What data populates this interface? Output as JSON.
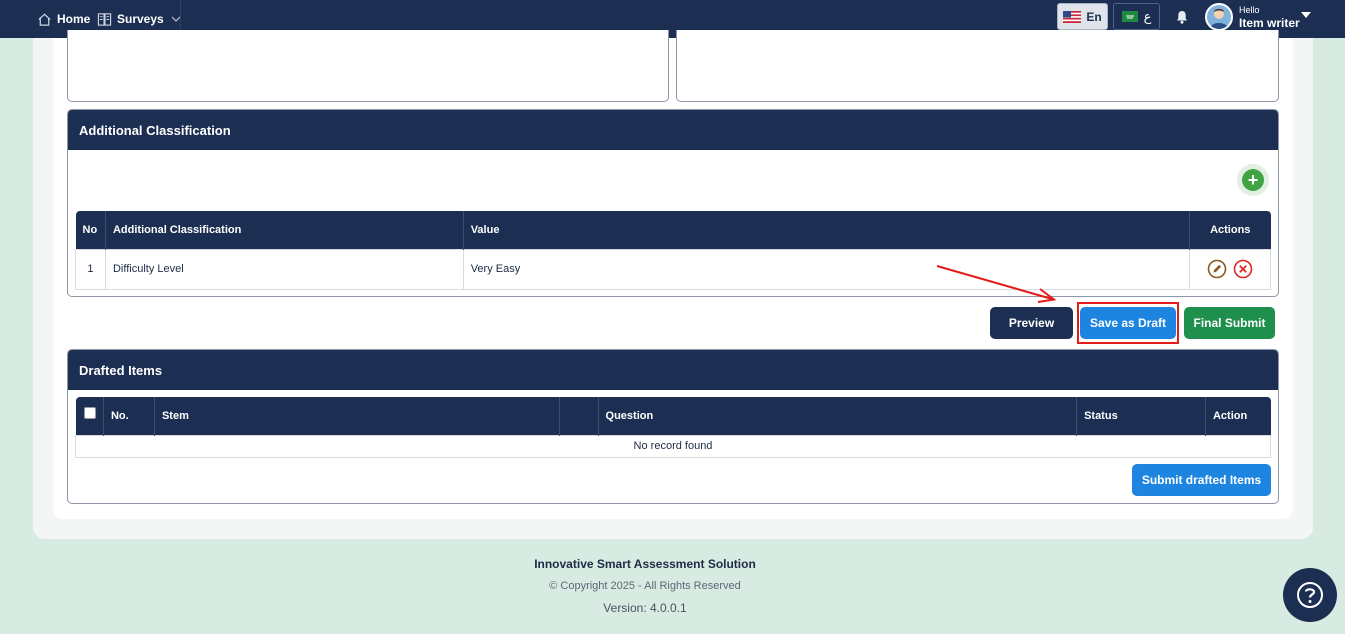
{
  "nav": {
    "home_label": "Home",
    "surveys_label": "Surveys",
    "lang_en": "En",
    "lang_ar": "ع",
    "greeting": "Hello",
    "user_name": "Item writer"
  },
  "additional_classification": {
    "title": "Additional Classification",
    "columns": [
      "No",
      "Additional Classification",
      "Value",
      "Actions"
    ],
    "rows": [
      {
        "no": "1",
        "classification": "Difficulty Level",
        "value": "Very Easy"
      }
    ]
  },
  "actions": {
    "preview_label": "Preview",
    "save_draft_label": "Save as Draft",
    "final_submit_label": "Final Submit"
  },
  "drafted_items": {
    "title": "Drafted Items",
    "columns": [
      "No.",
      "Stem",
      "",
      "Question",
      "Status",
      "Action"
    ],
    "empty_message": "No record found",
    "submit_label": "Submit drafted Items"
  },
  "footer": {
    "title": "Innovative Smart Assessment Solution",
    "copyright": "© Copyright 2025 - All Rights Reserved",
    "version": "Version: 4.0.0.1"
  },
  "colors": {
    "navy": "#1c2f52",
    "blue": "#1d84e0",
    "green": "#1e8f4c",
    "annotation_red": "#e31b1b",
    "background": "#d8ebe2"
  },
  "icons": [
    "home-icon",
    "surveys-icon",
    "chevron-down-icon",
    "us-flag-icon",
    "saudi-flag-icon",
    "bell-icon",
    "avatar",
    "plus-icon",
    "edit-icon",
    "delete-icon",
    "checkbox",
    "help-icon"
  ]
}
